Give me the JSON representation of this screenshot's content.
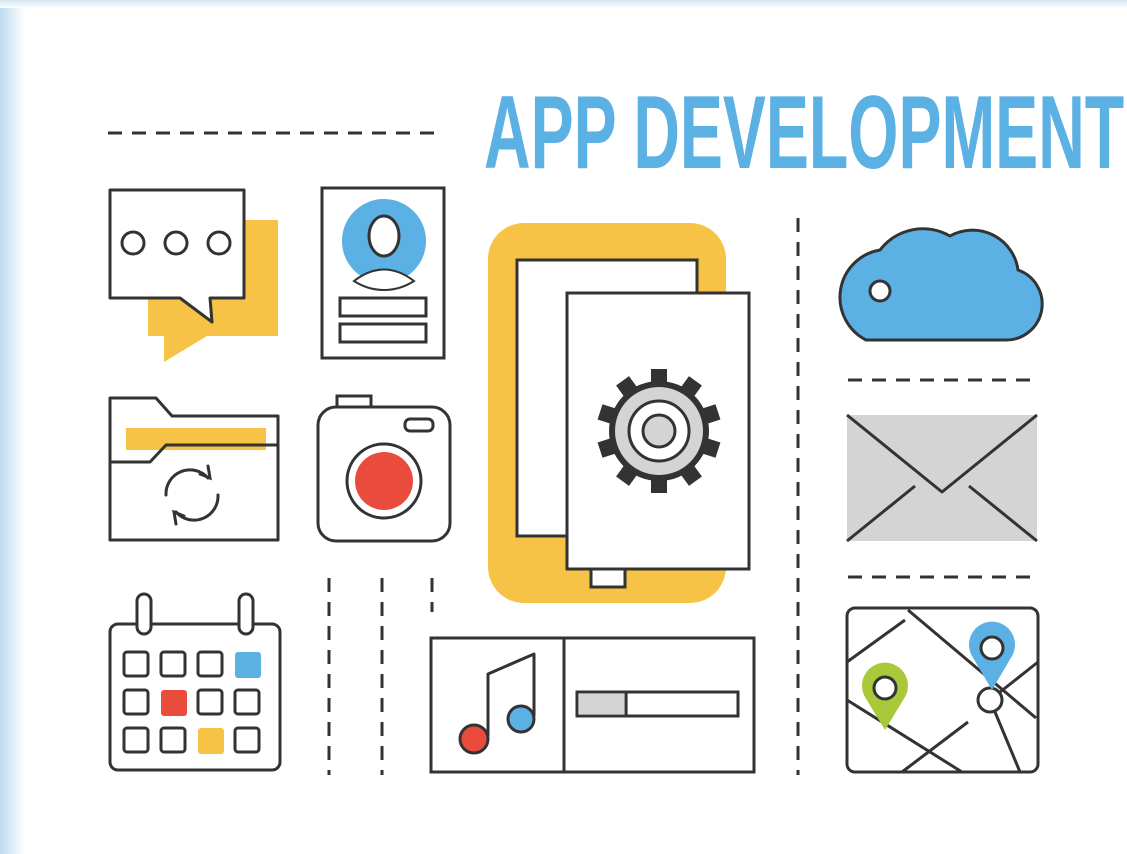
{
  "header": {
    "title": "APP DEVELOPMENT"
  },
  "colors": {
    "outline": "#333333",
    "blue": "#5bb0e4",
    "yellow": "#f6c347",
    "red": "#e94b3c",
    "green": "#a9c93b",
    "gray": "#d4d4d4",
    "background": "#ffffff"
  },
  "icons": [
    "chat-bubble-icon",
    "profile-card-icon",
    "smartphone-settings-icon",
    "cloud-icon",
    "folder-sync-icon",
    "camera-icon",
    "envelope-icon",
    "calendar-icon",
    "music-player-icon",
    "map-location-icon"
  ],
  "music_player": {
    "progress": 0.3
  }
}
